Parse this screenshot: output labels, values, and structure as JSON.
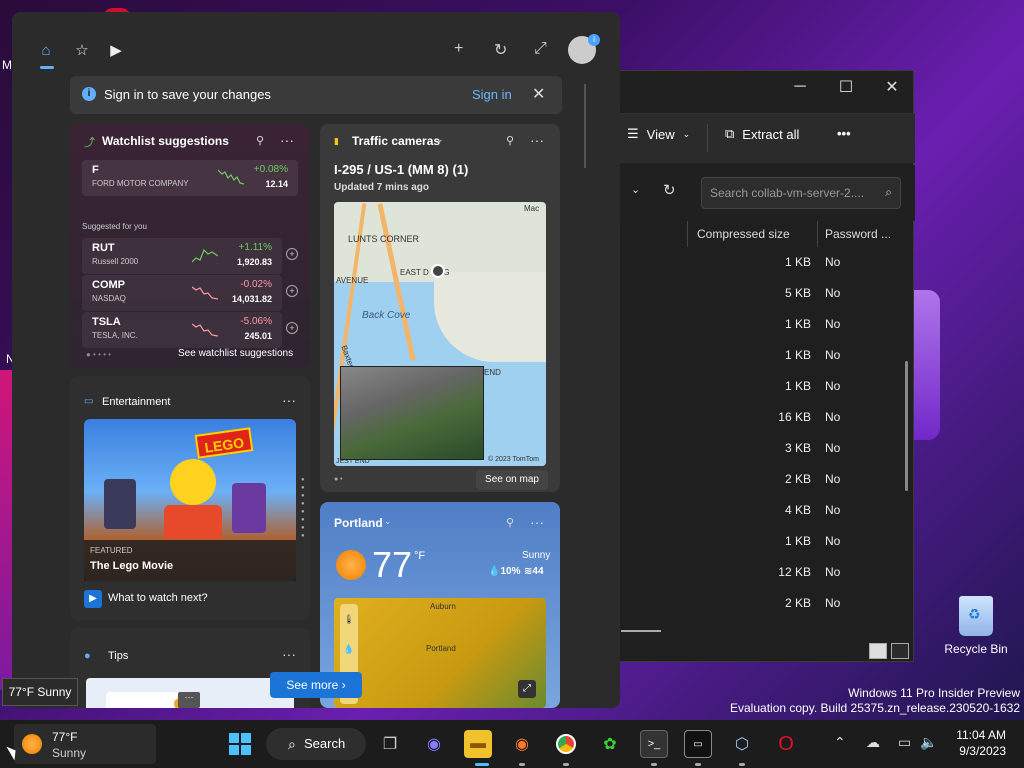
{
  "desktop": {
    "recycle_bin_label": "Recycle Bin",
    "edge_letters": [
      "M",
      "N"
    ],
    "windows_info_line1": "Windows 11 Pro Insider Preview",
    "windows_info_line2": "Evaluation copy. Build 25375.zn_release.230520-1632"
  },
  "explorer": {
    "toolbar": {
      "view_label": "View",
      "extract_label": "Extract all",
      "more_label": "•••"
    },
    "search_placeholder": "Search collab-vm-server-2....",
    "columns": {
      "compressed": "Compressed size",
      "password": "Password ..."
    },
    "rows": [
      {
        "size": "1 KB",
        "password": "No"
      },
      {
        "size": "5 KB",
        "password": "No"
      },
      {
        "size": "1 KB",
        "password": "No"
      },
      {
        "size": "1 KB",
        "password": "No"
      },
      {
        "size": "1 KB",
        "password": "No"
      },
      {
        "size": "16 KB",
        "password": "No"
      },
      {
        "size": "3 KB",
        "password": "No"
      },
      {
        "size": "2 KB",
        "password": "No"
      },
      {
        "size": "4 KB",
        "password": "No"
      },
      {
        "size": "1 KB",
        "password": "No"
      },
      {
        "size": "12 KB",
        "password": "No"
      },
      {
        "size": "2 KB",
        "password": "No"
      }
    ]
  },
  "widgets": {
    "signin": {
      "message": "Sign in to save your changes",
      "link": "Sign in"
    },
    "watchlist": {
      "title": "Watchlist suggestions",
      "top": {
        "symbol": "F",
        "name": "FORD MOTOR COMPANY",
        "change": "+0.08%",
        "price": "12.14"
      },
      "suggested_label": "Suggested for you",
      "items": [
        {
          "symbol": "RUT",
          "name": "Russell 2000",
          "change": "+1.11%",
          "price": "1,920.83"
        },
        {
          "symbol": "COMP",
          "name": "NASDAQ",
          "change": "-0.02%",
          "price": "14,031.82"
        },
        {
          "symbol": "TSLA",
          "name": "TESLA, INC.",
          "change": "-5.06%",
          "price": "245.01"
        }
      ],
      "see_link": "See watchlist suggestions",
      "colors": {
        "up": "#6ccb5f",
        "down": "#ff99a4"
      }
    },
    "entertainment": {
      "title": "Entertainment",
      "featured_label": "FEATURED",
      "movie": "The Lego Movie",
      "poster_text": "LEGO",
      "watch_next": "What to watch next?"
    },
    "tips": {
      "title": "Tips"
    },
    "traffic": {
      "title": "Traffic cameras",
      "route": "I-295 / US-1 (MM 8) (1)",
      "updated": "Updated 7 mins ago",
      "map_labels": {
        "lunts": "LUNTS CORNER",
        "avenue": "AVENUE",
        "back_cove": "Back Cove",
        "east": "EAST D   ING",
        "end": "END",
        "mac": "Mac",
        "baxter": "Baxter",
        "jest": "JEST END"
      },
      "copyright": "© 2023 TomTom",
      "see_map": "See on map"
    },
    "weather": {
      "city": "Portland",
      "temp": "77",
      "unit": "°F",
      "condition": "Sunny",
      "precip": "10%",
      "wind": "44",
      "map_labels": {
        "auburn": "Auburn",
        "portland": "Portland"
      }
    },
    "see_more": "See more"
  },
  "tooltip": {
    "weather": "77°F Sunny"
  },
  "taskbar": {
    "weather_temp": "77°F",
    "weather_cond": "Sunny",
    "search_label": "Search",
    "clock_time": "11:04 AM",
    "clock_date": "9/3/2023"
  }
}
